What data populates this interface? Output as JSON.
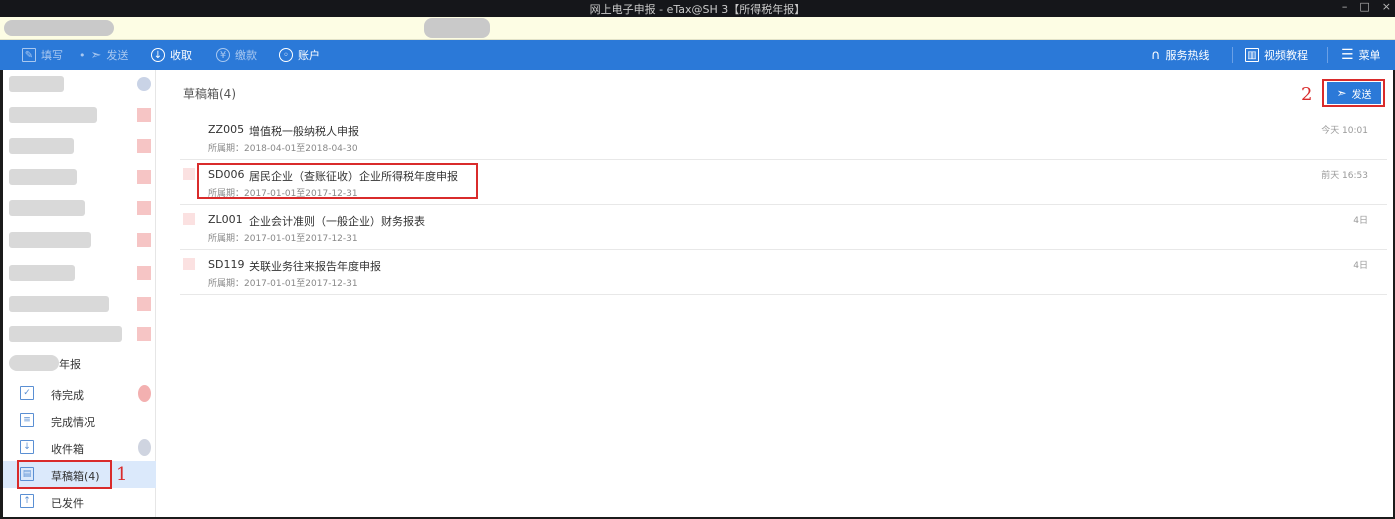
{
  "window": {
    "title": "网上电子申报 - eTax@SH 3【所得税年报】",
    "controls": [
      "–",
      "□",
      "×"
    ]
  },
  "toolbar": {
    "left": [
      {
        "icon": "edit-icon",
        "label": "填写",
        "enabled": false
      },
      {
        "icon": "paper-plane-icon",
        "label": "发送",
        "enabled": false
      },
      {
        "icon": "download-circle-icon",
        "label": "收取",
        "enabled": true
      },
      {
        "icon": "yen-circle-icon",
        "label": "缴款",
        "enabled": false
      },
      {
        "icon": "user-circle-icon",
        "label": "账户",
        "enabled": true
      }
    ],
    "right": [
      {
        "icon": "headset-icon",
        "label": "服务热线"
      },
      {
        "icon": "film-icon",
        "label": "视频教程"
      },
      {
        "icon": "hamburger-menu-icon",
        "label": "菜单"
      }
    ]
  },
  "sidebar": {
    "year_group_label": "年报",
    "nav": [
      {
        "icon": "clipboard-check-icon",
        "label": "待完成",
        "active": false
      },
      {
        "icon": "list-icon",
        "label": "完成情况",
        "active": false
      },
      {
        "icon": "inbox-icon",
        "label": "收件箱",
        "active": false
      },
      {
        "icon": "draft-doc-icon",
        "label": "草稿箱(4)",
        "active": true
      },
      {
        "icon": "upload-icon",
        "label": "已发件",
        "active": false
      }
    ]
  },
  "content": {
    "folder_title": "草稿箱(4)",
    "send_button": "发送",
    "period_label": "所属期：",
    "drafts": [
      {
        "code": "ZZ005",
        "name": "增值税一般纳税人申报",
        "period": "2018-04-01至2018-04-30",
        "time": "今天 10:01"
      },
      {
        "code": "SD006",
        "name": "居民企业（查账征收）企业所得税年度申报",
        "period": "2017-01-01至2017-12-31",
        "time": "前天 16:53"
      },
      {
        "code": "ZL001",
        "name": "企业会计准则（一般企业）财务报表",
        "period": "2017-01-01至2017-12-31",
        "time": "4日"
      },
      {
        "code": "SD119",
        "name": "关联业务往来报告年度申报",
        "period": "2017-01-01至2017-12-31",
        "time": "4日"
      }
    ]
  },
  "annotations": {
    "step1": "1",
    "step2": "2"
  },
  "colors": {
    "accent": "#2b79d8",
    "annotation": "#d92b2b",
    "active_nav": "#dbe9fb"
  }
}
